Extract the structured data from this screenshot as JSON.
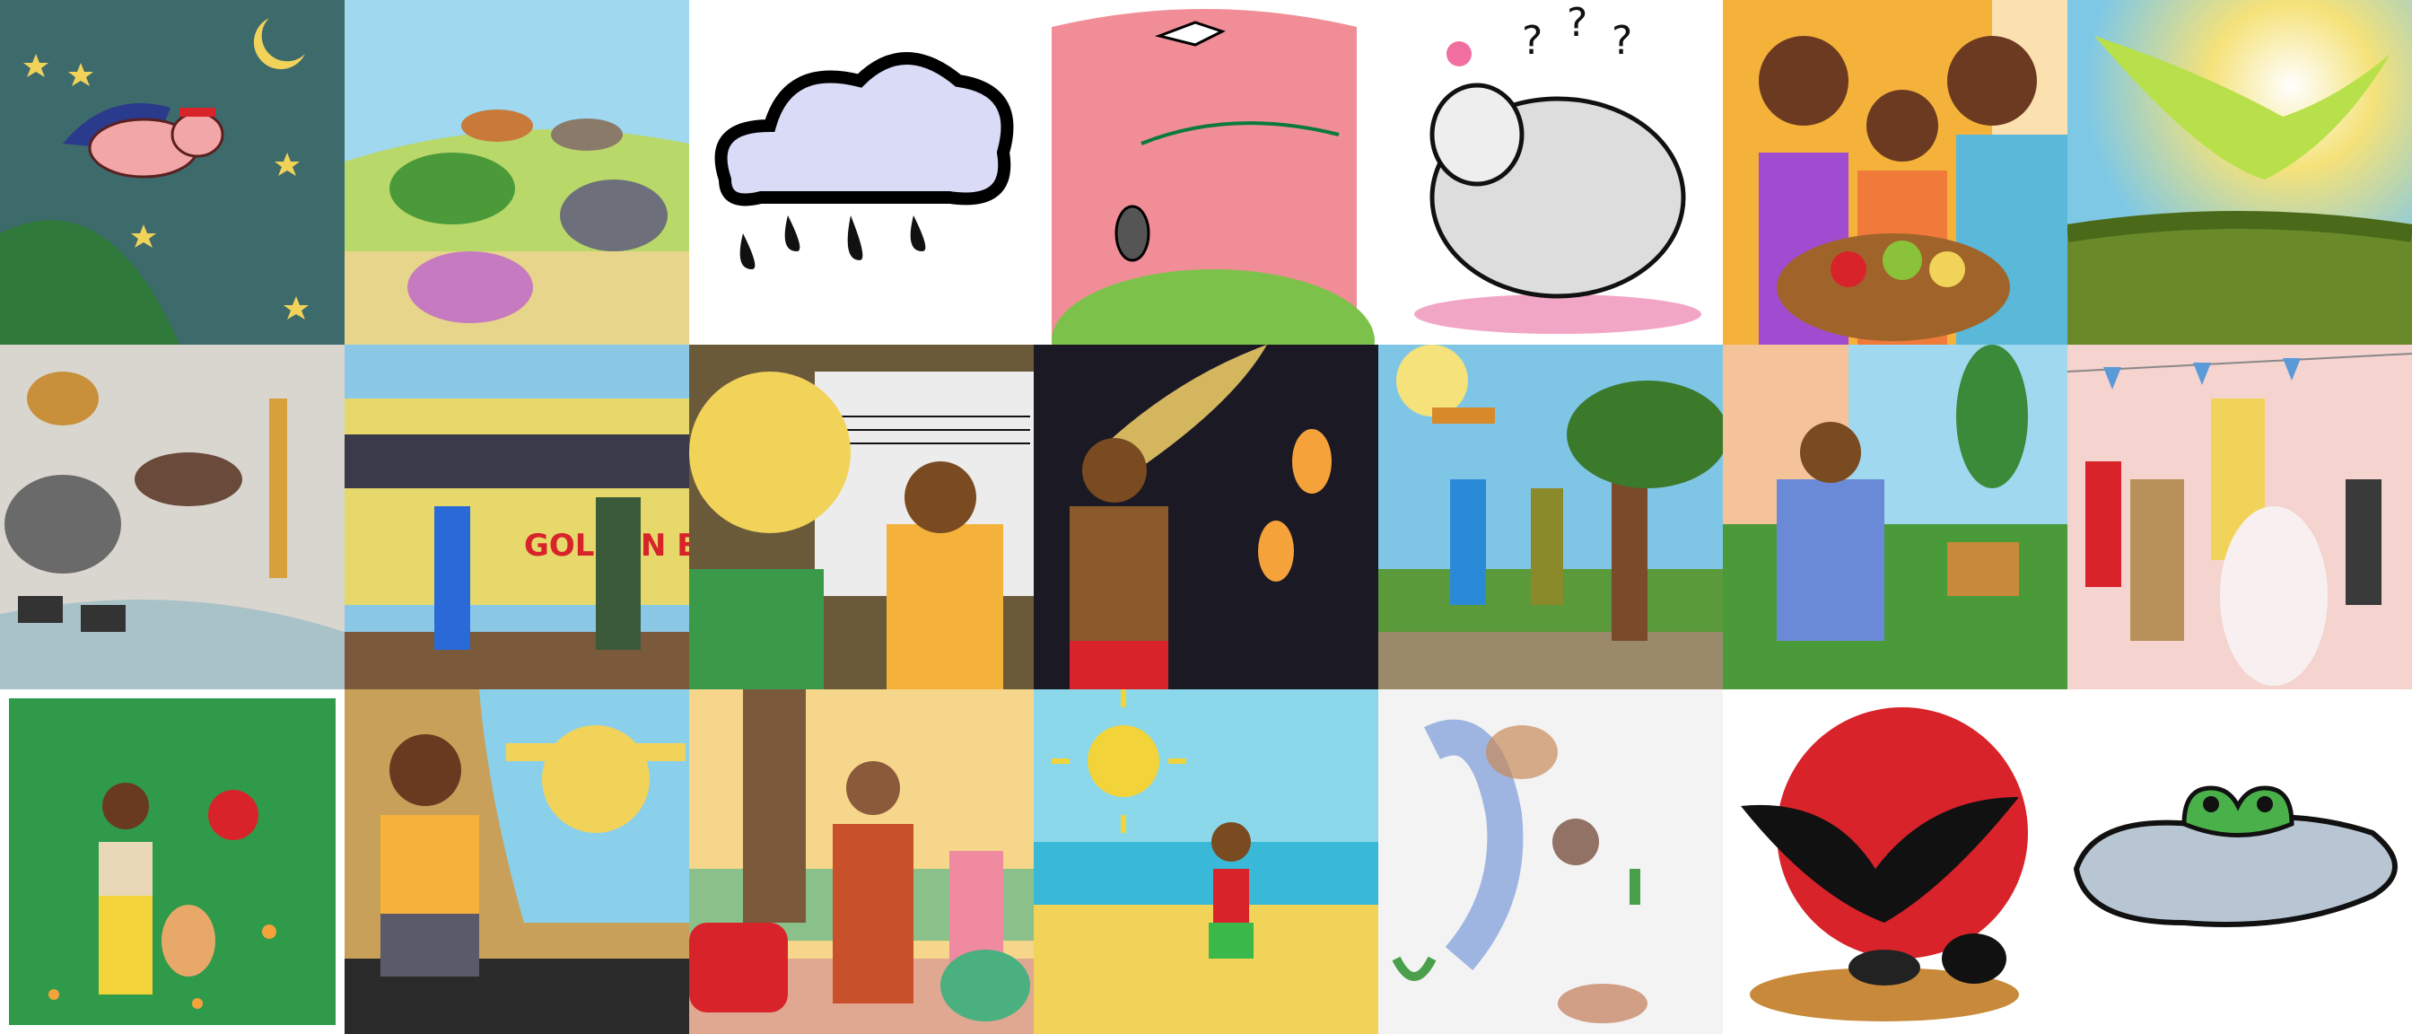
{
  "grid": {
    "rows": 3,
    "columns": 7
  },
  "tiles": [
    {
      "name": "tile-flying-cow-night"
    },
    {
      "name": "tile-antelopes-and-pig"
    },
    {
      "name": "tile-rain-cloud"
    },
    {
      "name": "tile-bird-and-ant"
    },
    {
      "name": "tile-confused-elephant"
    },
    {
      "name": "tile-children-fruit-basket"
    },
    {
      "name": "tile-green-bird-sun"
    },
    {
      "name": "tile-savanna-animals"
    },
    {
      "name": "tile-bus-station"
    },
    {
      "name": "tile-music-classroom"
    },
    {
      "name": "tile-fire-dancer"
    },
    {
      "name": "tile-people-under-tree"
    },
    {
      "name": "tile-woman-in-garden"
    },
    {
      "name": "tile-wedding-family"
    },
    {
      "name": "tile-boy-dog-ball"
    },
    {
      "name": "tile-boy-reading-airplane"
    },
    {
      "name": "tile-women-with-bags"
    },
    {
      "name": "tile-girl-beach-icecream"
    },
    {
      "name": "tile-woman-and-hare-sketch"
    },
    {
      "name": "tile-eagle-and-hen"
    },
    {
      "name": "tile-crocodile-in-pond"
    }
  ],
  "colors": {
    "night": "#3d6a6b",
    "hill": "#2f7a3a",
    "sky": "#7fc6e6",
    "pink": "#f08d96",
    "grass": "#7cc24a",
    "orange": "#f4b23a",
    "classroom": "#5a5a5a",
    "stage": "#1b1a24",
    "green_bg": "#2f9a4a",
    "red": "#d8232a",
    "pond": "#b8c6d3"
  },
  "text_marks": {
    "bus_sign": "GOLDEN B"
  }
}
